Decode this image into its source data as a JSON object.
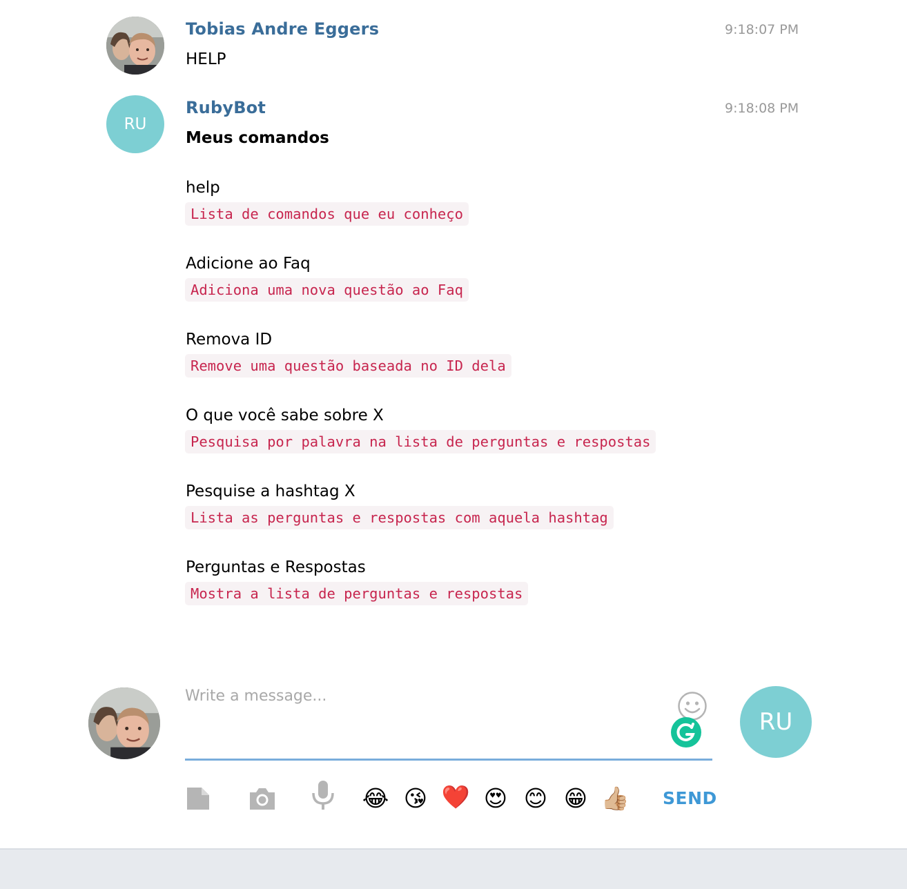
{
  "messages": [
    {
      "sender": "Tobias Andre Eggers",
      "time": "9:18:07 PM",
      "text": "HELP"
    },
    {
      "sender": "RubyBot",
      "avatar_initials": "RU",
      "time": "9:18:08 PM",
      "title": "Meus comandos",
      "commands": [
        {
          "name": "help",
          "description": "Lista de comandos que eu conheço"
        },
        {
          "name": "Adicione ao Faq",
          "description": "Adiciona uma nova questão ao Faq"
        },
        {
          "name": "Remova ID",
          "description": "Remove uma questão baseada no ID dela"
        },
        {
          "name": "O que você sabe sobre X",
          "description": "Pesquisa por palavra na lista de perguntas e respostas"
        },
        {
          "name": "Pesquise a hashtag X",
          "description": "Lista as perguntas e respostas com aquela hashtag"
        },
        {
          "name": "Perguntas e Respostas",
          "description": "Mostra a lista de perguntas e respostas"
        }
      ]
    }
  ],
  "composer": {
    "placeholder": "Write a message...",
    "bot_avatar_initials": "RU",
    "send_label": "SEND",
    "emojis": [
      "😂",
      "😘",
      "❤️",
      "😍",
      "😊",
      "😁",
      "👍🏼"
    ],
    "icons": [
      "file-icon",
      "camera-icon",
      "microphone-icon",
      "smiley-icon",
      "grammarly-icon"
    ]
  },
  "colors": {
    "sender_name": "#3a6d99",
    "bot_avatar": "#7dcfd3",
    "code_text": "#c7254e",
    "code_background": "#f7f2f4",
    "send": "#3e98d6",
    "input_underline": "#79addb"
  }
}
